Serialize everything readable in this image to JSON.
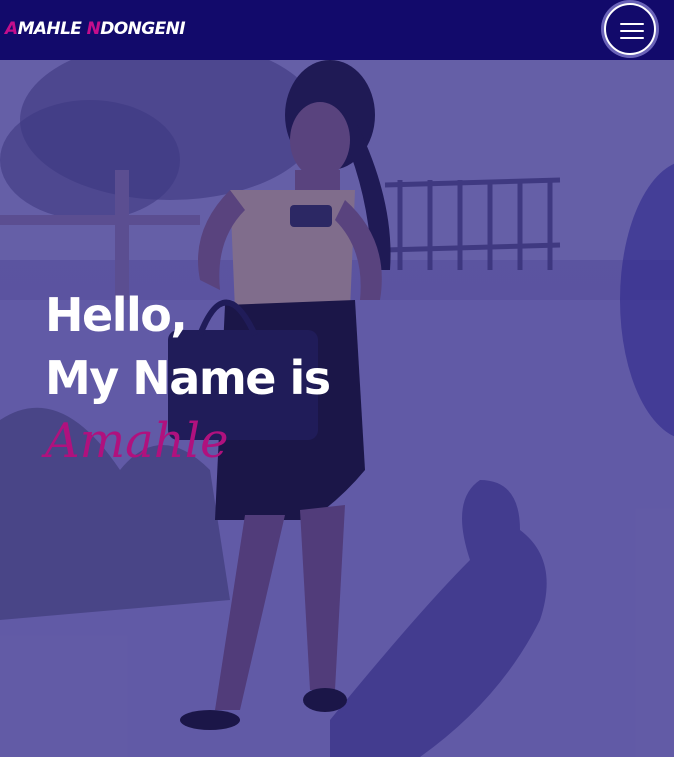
{
  "navbar": {
    "brand_first_initial": "A",
    "brand_first_rest": "MAHLE ",
    "brand_last_initial": "N",
    "brand_last_rest": "DONGENI",
    "menu_icon": "hamburger-menu-icon"
  },
  "hero": {
    "greeting": "Hello,",
    "intro": "My Name is",
    "name": "Amahle",
    "image_subject": "woman with braids holding a handbag and phone"
  },
  "colors": {
    "navbar_bg": "#120a6b",
    "overlay": "#5a4f9e",
    "accent": "#c40e8c",
    "text": "#ffffff"
  }
}
